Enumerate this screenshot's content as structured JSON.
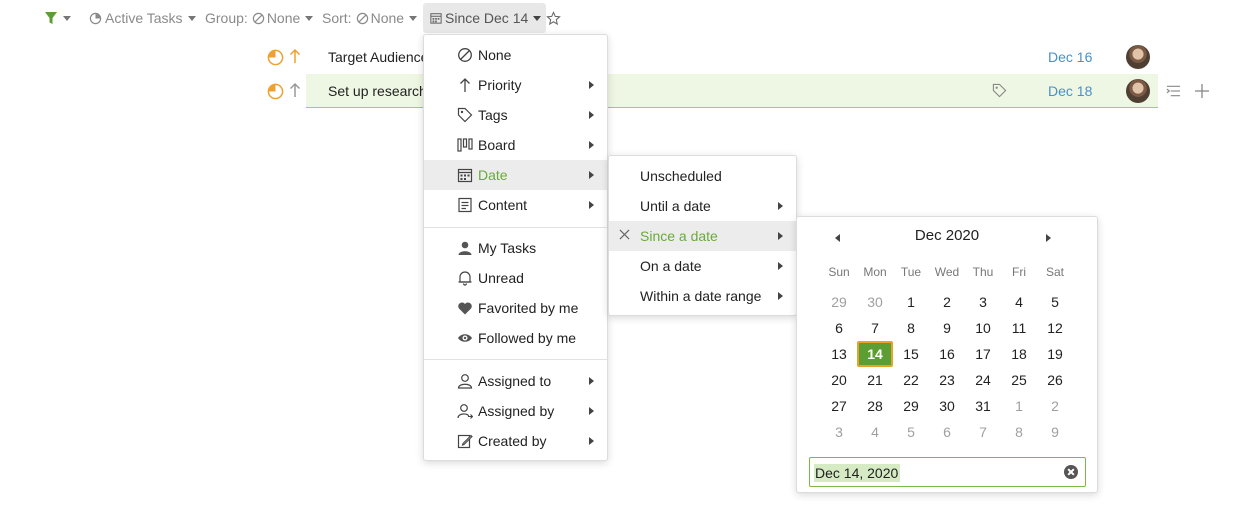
{
  "colors": {
    "accent_green": "#6aaa3a",
    "date_blue": "#4a90c8",
    "selected_day": "#5c9e34",
    "highlight_border": "#e5a52b"
  },
  "toolbar": {
    "filter_icon": "funnel-icon",
    "active_tasks": "Active Tasks",
    "group_prefix": "Group:",
    "group_value": "None",
    "sort_prefix": "Sort:",
    "sort_value": "None",
    "since_label": "Since Dec 14",
    "star_icon": "star-icon"
  },
  "tasks": [
    {
      "title": "Target Audience",
      "date": "Dec 16",
      "status_icon": "in-progress-icon",
      "priority_icon": "arrow-up-icon"
    },
    {
      "title": "Set up research",
      "date": "Dec 18",
      "status_icon": "in-progress-icon",
      "priority_icon": "arrow-up-icon"
    }
  ],
  "main_menu": {
    "items": [
      {
        "label": "None",
        "icon": "none-icon"
      },
      {
        "label": "Priority",
        "icon": "priority-icon"
      },
      {
        "label": "Tags",
        "icon": "tag-icon"
      },
      {
        "label": "Board",
        "icon": "board-icon"
      },
      {
        "label": "Date",
        "icon": "calendar-icon"
      },
      {
        "label": "Content",
        "icon": "content-icon"
      },
      {
        "label": "My Tasks",
        "icon": "user-icon"
      },
      {
        "label": "Unread",
        "icon": "bell-icon"
      },
      {
        "label": "Favorited by me",
        "icon": "heart-icon"
      },
      {
        "label": "Followed by me",
        "icon": "eye-icon"
      },
      {
        "label": "Assigned to",
        "icon": "assigned-to-icon"
      },
      {
        "label": "Assigned by",
        "icon": "assigned-by-icon"
      },
      {
        "label": "Created by",
        "icon": "created-by-icon"
      }
    ],
    "active": "Date"
  },
  "date_menu": {
    "items": [
      {
        "label": "Unscheduled"
      },
      {
        "label": "Until a date"
      },
      {
        "label": "Since a date"
      },
      {
        "label": "On a date"
      },
      {
        "label": "Within a date range"
      }
    ],
    "active": "Since a date"
  },
  "calendar": {
    "title": "Dec 2020",
    "weekdays": [
      "Sun",
      "Mon",
      "Tue",
      "Wed",
      "Thu",
      "Fri",
      "Sat"
    ],
    "weeks": [
      [
        "29",
        "30",
        "1",
        "2",
        "3",
        "4",
        "5"
      ],
      [
        "6",
        "7",
        "8",
        "9",
        "10",
        "11",
        "12"
      ],
      [
        "13",
        "14",
        "15",
        "16",
        "17",
        "18",
        "19"
      ],
      [
        "20",
        "21",
        "22",
        "23",
        "24",
        "25",
        "26"
      ],
      [
        "27",
        "28",
        "29",
        "30",
        "31",
        "1",
        "2"
      ],
      [
        "3",
        "4",
        "5",
        "6",
        "7",
        "8",
        "9"
      ]
    ],
    "selected_day": "14",
    "input_value": "Dec 14, 2020"
  }
}
